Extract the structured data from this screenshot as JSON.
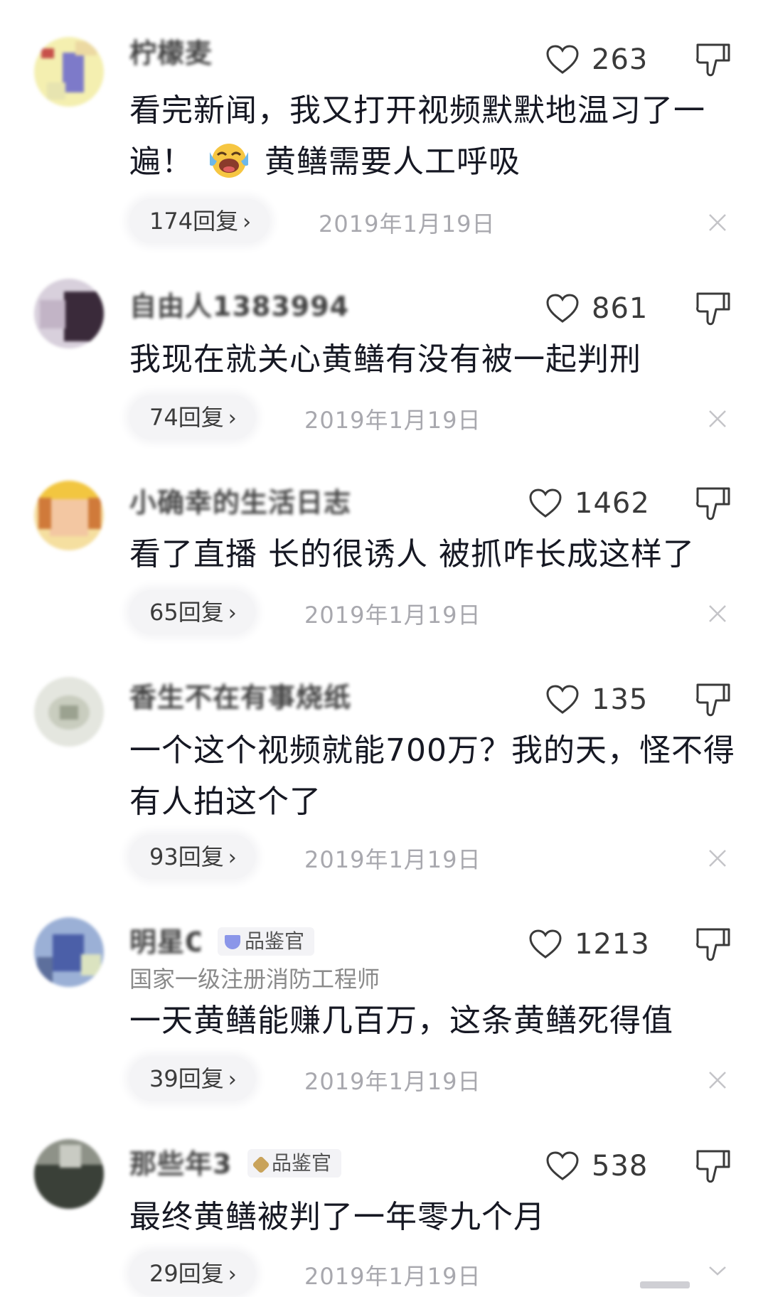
{
  "comments": [
    {
      "username": "柠檬麦",
      "subtitle": "",
      "badge": "",
      "likes": "263",
      "text": "看完新闻，我又打开视频默默地温习了一遍！",
      "text_after_emoji": "黄鳝需要人工呼吸",
      "emoji": "laughing-crying-emoji",
      "replies": "174回复",
      "date": "2019年1月19日"
    },
    {
      "username": "自由人1383994",
      "subtitle": "",
      "badge": "",
      "likes": "861",
      "text": "我现在就关心黄鳝有没有被一起判刑",
      "replies": "74回复",
      "date": "2019年1月19日"
    },
    {
      "username": "小确幸的生活日志",
      "subtitle": "",
      "badge": "",
      "likes": "1462",
      "text": "看了直播 长的很诱人 被抓咋长成这样了",
      "replies": "65回复",
      "date": "2019年1月19日"
    },
    {
      "username": "香生不在有事烧纸",
      "subtitle": "",
      "badge": "",
      "likes": "135",
      "text": "一个这个视频就能700万？我的天，怪不得有人拍这个了",
      "replies": "93回复",
      "date": "2019年1月19日"
    },
    {
      "username": "明星O",
      "subtitle": "国家一级注册消防工程师",
      "badge": "品鉴官",
      "likes": "1213",
      "text": "一天黄鳝能赚几百万，这条黄鳝死得值",
      "replies": "39回复",
      "date": "2019年1月19日"
    },
    {
      "username": "那些年3",
      "subtitle": "",
      "badge": "品鉴官",
      "likes": "538",
      "text": "最终黄鳝被判了一年零九个月",
      "replies": "29回复",
      "date": "2019年1月19日"
    }
  ],
  "icons": {
    "like": "heart-outline-icon",
    "dislike": "thumbs-down-outline-icon",
    "close": "close-icon",
    "chevron": "chevron-right-icon",
    "more": "chevron-down-icon"
  },
  "colors": {
    "text": "#161823",
    "secondary": "#a8a8ae",
    "badge_bg": "#f3f3f6",
    "badge_icon_blue": "#8b96e9",
    "badge_icon_gold": "#c9a35b"
  }
}
